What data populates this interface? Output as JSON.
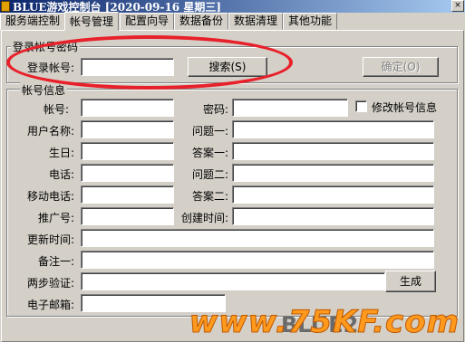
{
  "window": {
    "title": "BLUE游戏控制台 [2020-09-16 星期三]",
    "close_label": "×"
  },
  "tabs": [
    {
      "label": "服务端控制"
    },
    {
      "label": "帐号管理"
    },
    {
      "label": "配置向导"
    },
    {
      "label": "数据备份"
    },
    {
      "label": "数据清理"
    },
    {
      "label": "其他功能"
    }
  ],
  "login_group": {
    "title": "登录帐号密码",
    "account_label": "登录帐号:",
    "account_value": "",
    "search_label": "搜索(S)",
    "confirm_label": "确定(O)"
  },
  "info_group": {
    "title": "帐号信息",
    "account_label": "帐号:",
    "password_label": "密码:",
    "modify_checkbox_label": "修改帐号信息",
    "username_label": "用户名称:",
    "question1_label": "问题一:",
    "birthday_label": "生日:",
    "answer1_label": "答案一:",
    "phone_label": "电话:",
    "question2_label": "问题二:",
    "mobile_label": "移动电话:",
    "answer2_label": "答案二:",
    "promo_label": "推广号:",
    "created_label": "创建时间:",
    "updated_label": "更新时间:",
    "note1_label": "备注一:",
    "twofa_label": "两步验证:",
    "generate_label": "生成",
    "email_label": "电子邮箱:"
  },
  "watermark": {
    "text": "www.75KF.com",
    "under_text": "BLUE2"
  },
  "colors": {
    "highlight_oval": "#e8202a",
    "watermark": "#ff9a1e"
  }
}
